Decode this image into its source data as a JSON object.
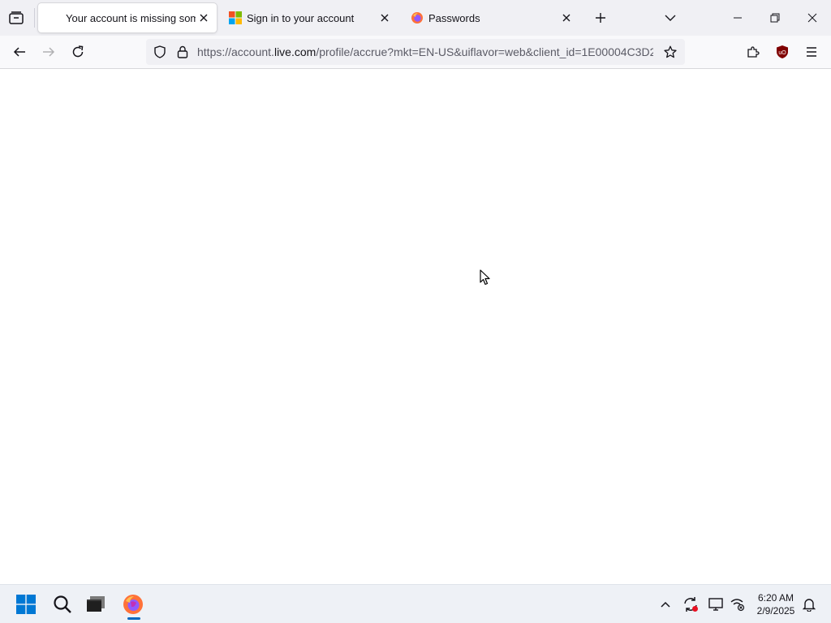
{
  "browser": {
    "tabs": [
      {
        "title": "Your account is missing some info",
        "active": true,
        "favicon": "blank-favicon"
      },
      {
        "title": "Sign in to your account",
        "active": false,
        "favicon": "microsoft-logo-icon"
      },
      {
        "title": "Passwords",
        "active": false,
        "favicon": "firefox-icon"
      }
    ],
    "url": {
      "prefix": "https://account.",
      "host": "live.com",
      "rest": "/profile/accrue?mkt=EN-US&uiflavor=web&client_id=1E00004C3D2"
    },
    "extension_label": "uO",
    "colors": {
      "accent": "#0067c0",
      "ublock": "#800000",
      "ms_red": "#f25022",
      "ms_green": "#7fba00",
      "ms_blue": "#00a4ef",
      "ms_yellow": "#ffb900"
    }
  },
  "taskbar": {
    "time": "6:20 AM",
    "date": "2/9/2025",
    "pinned": [
      "windows-start-icon",
      "search-icon",
      "terminal-icon",
      "firefox-icon"
    ],
    "tray": [
      "chevron-up-icon",
      "sync-icon",
      "display-icon",
      "wifi-off-icon",
      "bell-icon"
    ]
  }
}
